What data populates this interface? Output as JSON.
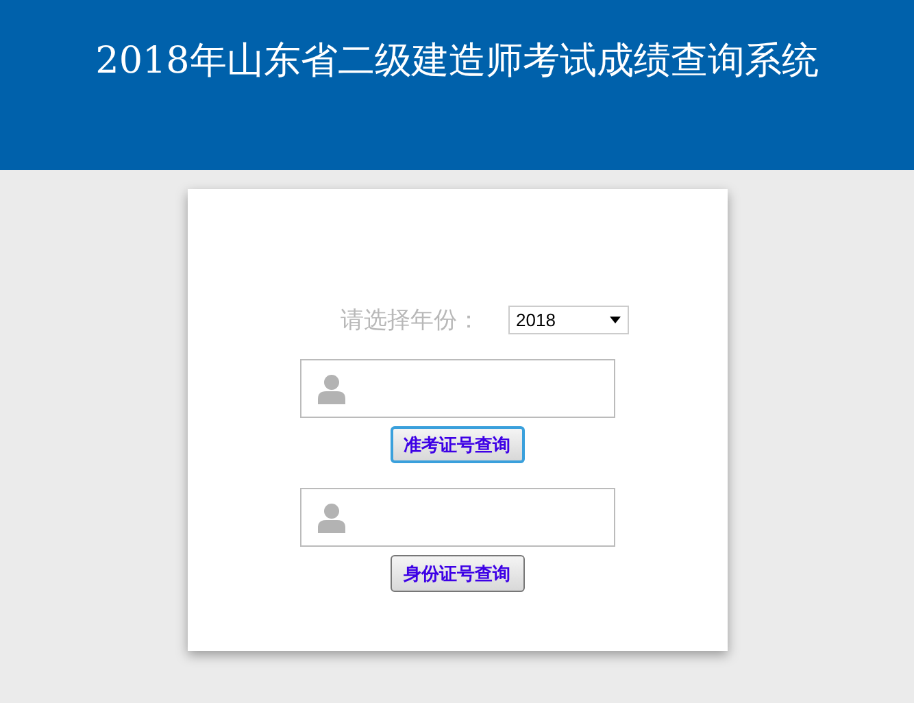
{
  "header": {
    "title": "2018年山东省二级建造师考试成绩查询系统"
  },
  "year": {
    "label": "请选择年份：",
    "value": "2018"
  },
  "queries": [
    {
      "button": "准考证号查询",
      "focused": true
    },
    {
      "button": "身份证号查询",
      "focused": false
    }
  ]
}
